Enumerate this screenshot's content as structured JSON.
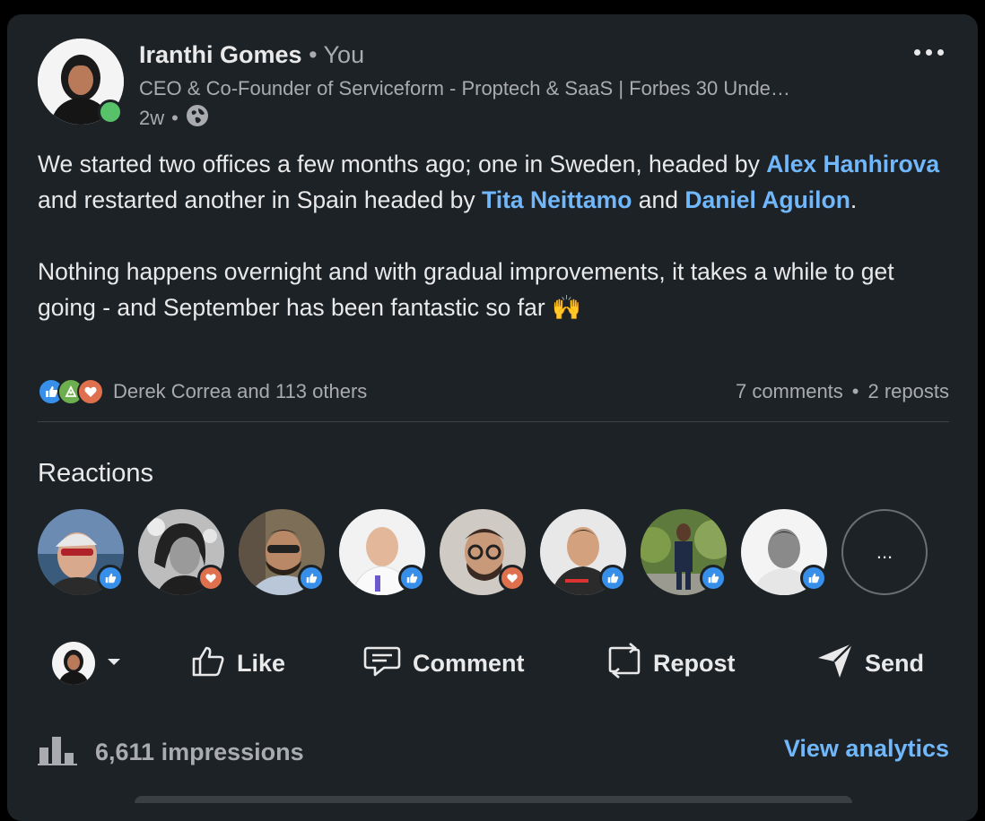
{
  "author": {
    "name": "Iranthi Gomes",
    "relation": "You",
    "headline": "CEO & Co-Founder of Serviceform - Proptech & SaaS | Forbes 30 Unde…",
    "time": "2w",
    "visibility_icon": "globe-icon"
  },
  "post": {
    "p1_a": "We started two offices a few months ago; one in Sweden, headed by ",
    "mention1": "Alex Hanhirova",
    "p1_b": " and restarted another in Spain headed by ",
    "mention2": "Tita Neittamo",
    "p1_c": " and ",
    "mention3": "Daniel Aguilon",
    "p1_d": ".",
    "p2": "Nothing happens overnight and with gradual improvements, it takes a while to get going - and September has been fantastic so far 🙌"
  },
  "social": {
    "reactors_text": "Derek Correa and 113 others",
    "comments": "7 comments",
    "reposts": "2 reposts",
    "reaction_icons": [
      "like-icon",
      "celebrate-icon",
      "love-icon"
    ]
  },
  "reactions": {
    "title": "Reactions",
    "people": [
      {
        "name": "reactor-1",
        "badge": "like"
      },
      {
        "name": "reactor-2",
        "badge": "love"
      },
      {
        "name": "reactor-3",
        "badge": "like"
      },
      {
        "name": "reactor-4",
        "badge": "like"
      },
      {
        "name": "reactor-5",
        "badge": "love"
      },
      {
        "name": "reactor-6",
        "badge": "like"
      },
      {
        "name": "reactor-7",
        "badge": "like"
      },
      {
        "name": "reactor-8",
        "badge": "like"
      }
    ],
    "more_label": "..."
  },
  "actions": {
    "like": "Like",
    "comment": "Comment",
    "repost": "Repost",
    "send": "Send"
  },
  "footer": {
    "impressions": "6,611 impressions",
    "view_analytics": "View analytics"
  },
  "colors": {
    "background": "#1d2226",
    "link": "#71b7fb",
    "like_blue": "#378fe9",
    "love_red": "#df704d",
    "online": "#57c26a"
  }
}
